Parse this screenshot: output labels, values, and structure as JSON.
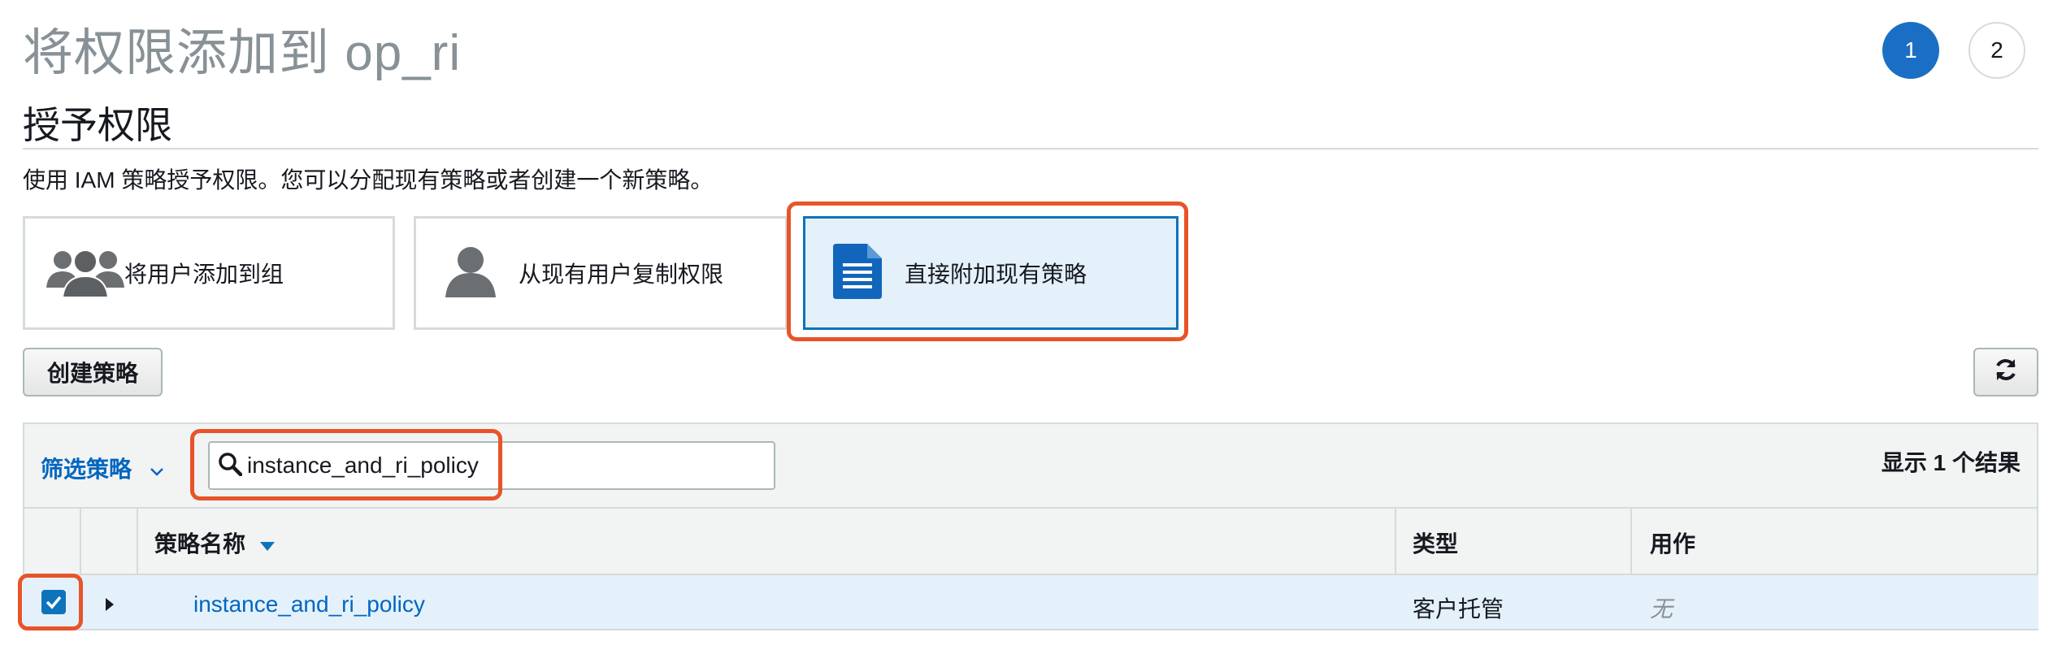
{
  "header": {
    "title": "将权限添加到 op_ri",
    "steps": [
      "1",
      "2"
    ]
  },
  "section": {
    "title": "授予权限",
    "description": "使用 IAM 策略授予权限。您可以分配现有策略或者创建一个新策略。"
  },
  "options": [
    {
      "label": "将用户添加到组",
      "icon": "users-group-icon"
    },
    {
      "label": "从现有用户复制权限",
      "icon": "user-icon"
    },
    {
      "label": "直接附加现有策略",
      "icon": "document-icon",
      "selected": true
    }
  ],
  "actions": {
    "create_policy": "创建策略",
    "refresh_icon": "refresh-icon"
  },
  "filter": {
    "label": "筛选策略",
    "search_value": "instance_and_ri_policy",
    "result_text": "显示 1 个结果"
  },
  "table": {
    "columns": [
      "策略名称",
      "类型",
      "用作"
    ],
    "rows": [
      {
        "name": "instance_and_ri_policy",
        "type": "客户托管",
        "usage": "无",
        "checked": true
      }
    ]
  },
  "colors": {
    "accent": "#0d73bb",
    "link": "#0066c0",
    "highlight": "#e8542a",
    "selected_bg": "#e4f1fb"
  }
}
